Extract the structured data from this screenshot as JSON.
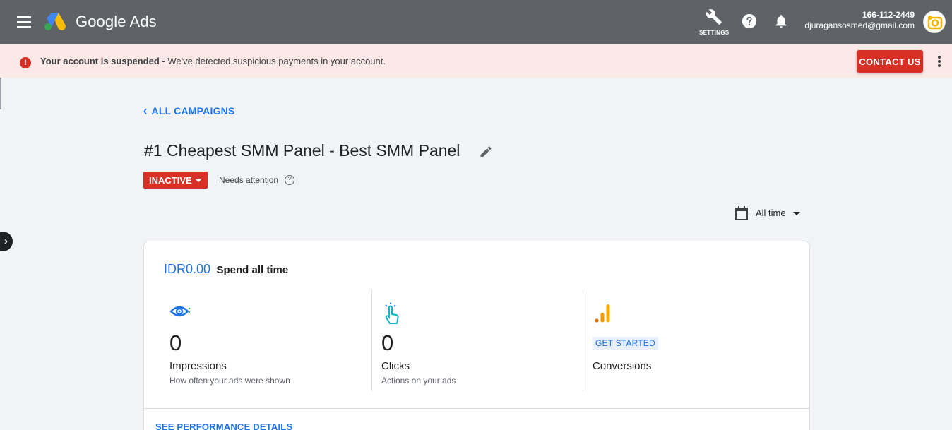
{
  "header": {
    "brand": "Google Ads",
    "settings_label": "SETTINGS",
    "customer_id": "166-112-2449",
    "email": "djuragansosmed@gmail.com"
  },
  "banner": {
    "bold_text": "Your account is suspended",
    "text": " - We've detected suspicious payments in your account.",
    "contact_label": "CONTACT US",
    "error_glyph": "!"
  },
  "nav": {
    "back_label": "ALL CAMPAIGNS",
    "side_toggle_glyph": "›"
  },
  "campaign": {
    "title": "#1 Cheapest SMM Panel - Best SMM Panel",
    "status": "INACTIVE",
    "needs_attention": "Needs attention"
  },
  "date_range": {
    "label": "All time"
  },
  "summary": {
    "spend_amount": "IDR0.00",
    "spend_label": "Spend all time",
    "metrics": [
      {
        "value": "0",
        "name": "Impressions",
        "desc": "How often your ads were shown",
        "icon": "eye-icon"
      },
      {
        "value": "0",
        "name": "Clicks",
        "desc": "Actions on your ads",
        "icon": "tap-icon"
      },
      {
        "cta": "GET STARTED",
        "name": "Conversions",
        "icon": "bar-chart-icon"
      }
    ],
    "details_link": "SEE PERFORMANCE DETAILS"
  },
  "colors": {
    "topbar": "#5f6368",
    "banner_bg": "#fce8e6",
    "error_red": "#d93025",
    "link_blue": "#1a73e8",
    "conversion_orange": "#f29900"
  }
}
